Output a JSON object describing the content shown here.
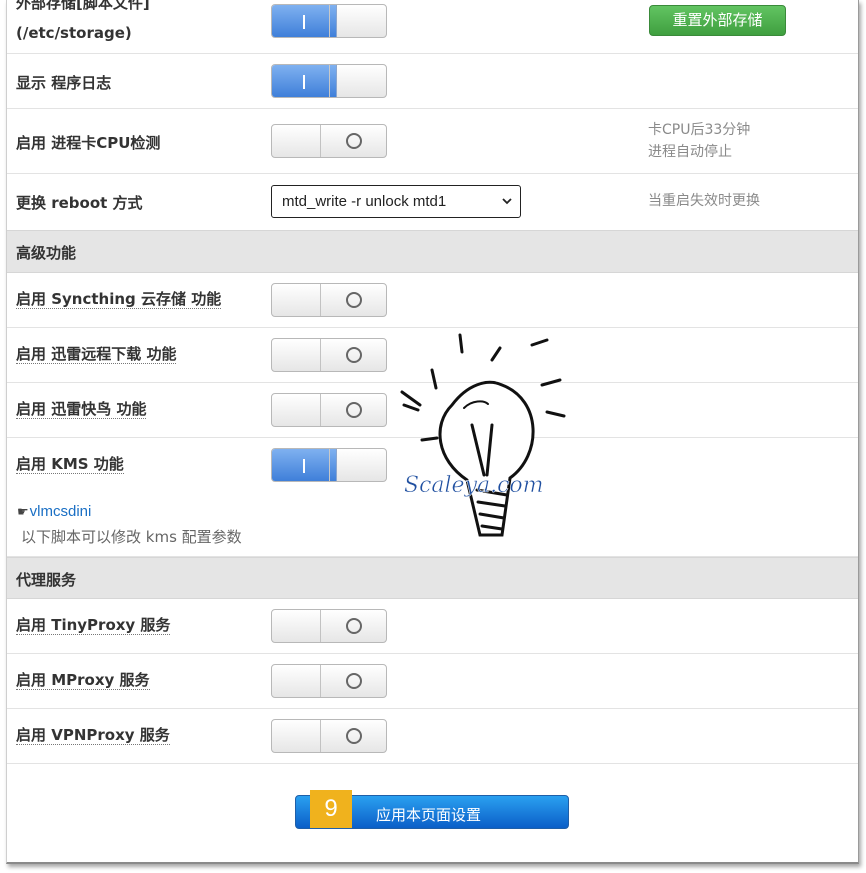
{
  "rows": {
    "storage": {
      "label_line1": "外部存储[脚本文件]",
      "label_line2": "(/etc/storage)",
      "button": "重置外部存储",
      "state": "on"
    },
    "show_log": {
      "label": "显示 程序日志",
      "state": "on"
    },
    "cpu_check": {
      "label": "启用 进程卡CPU检测",
      "state": "off",
      "hint_line1": "卡CPU后33分钟",
      "hint_line2": "进程自动停止"
    },
    "reboot": {
      "label": "更换 reboot 方式",
      "selected": "mtd_write -r unlock mtd1",
      "hint": "当重启失效时更换"
    }
  },
  "sections": {
    "advanced": "高级功能",
    "proxy": "代理服务"
  },
  "advanced_items": [
    {
      "label": "启用 Syncthing 云存储 功能",
      "state": "off"
    },
    {
      "label": "启用 迅雷远程下载 功能",
      "state": "off"
    },
    {
      "label": "启用 迅雷快鸟 功能",
      "state": "off"
    },
    {
      "label": "启用 KMS 功能",
      "state": "on"
    }
  ],
  "kms": {
    "link_icon": "☛",
    "link": "vlmcsdini",
    "note": "以下脚本可以修改 kms 配置参数"
  },
  "proxy_items": [
    {
      "label": "启用 TinyProxy 服务",
      "state": "off"
    },
    {
      "label": "启用 MProxy 服务",
      "state": "off"
    },
    {
      "label": "启用 VPNProxy 服务",
      "state": "off"
    }
  ],
  "apply": {
    "badge": "9",
    "label": "应用本页面设置"
  },
  "watermark": {
    "text": "Scaleya.com"
  },
  "colors": {
    "toggle_on": "#3f7fd9",
    "green_button": "#4cae4c",
    "apply_button": "#0b5fc8",
    "badge": "#f0b21d",
    "link": "#1a6fc4"
  }
}
